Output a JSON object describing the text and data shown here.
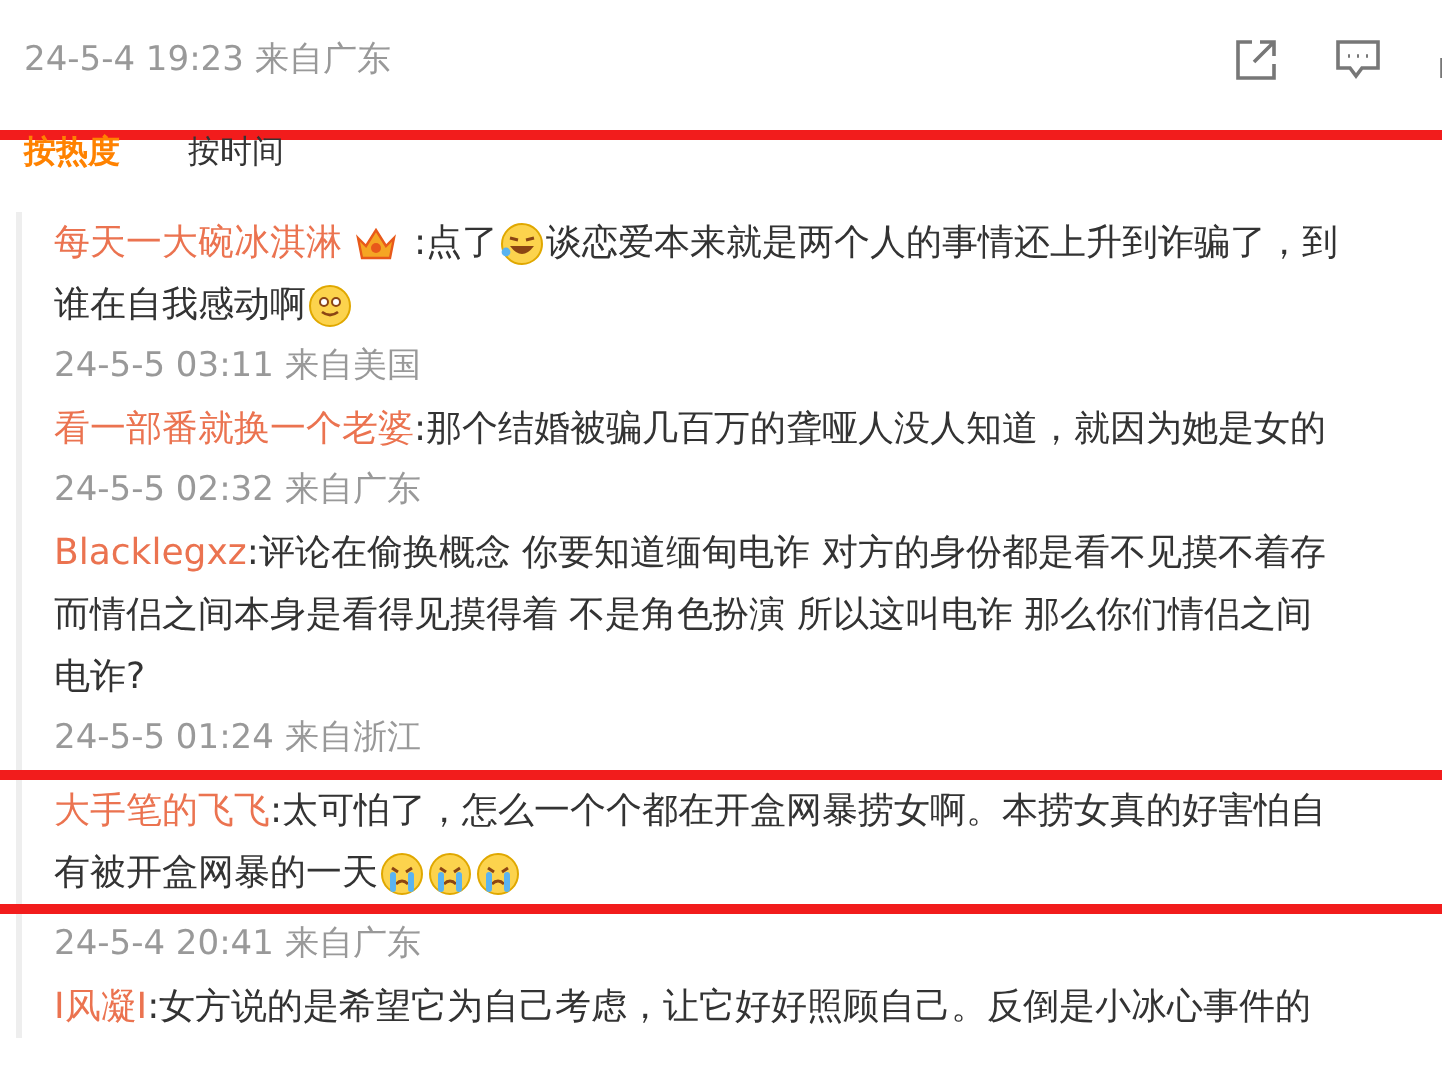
{
  "post": {
    "time": "24-5-4 19:23 来自广东"
  },
  "sort_tabs": [
    {
      "label": "按热度",
      "selected": true
    },
    {
      "label": "按时间",
      "selected": false
    }
  ],
  "comments": [
    {
      "user": "每天一大碗冰淇淋",
      "lines": [
        [
          {
            "kind": "badge"
          },
          {
            "kind": "text",
            "text": ":点了"
          },
          {
            "kind": "laugh"
          },
          {
            "kind": "text",
            "text": "谈恋爱本来就是两个人的事情还上升到诈骗了，到"
          }
        ],
        [
          {
            "kind": "text",
            "text": "谁在自我感动啊"
          },
          {
            "kind": "smile"
          }
        ]
      ],
      "time": "24-5-5 03:11 来自美国",
      "marked": false
    },
    {
      "user": "看一部番就换一个老婆",
      "lines": [
        [
          {
            "kind": "text",
            "text": ":那个结婚被骗几百万的聋哑人没人知道，就因为她是女的"
          }
        ]
      ],
      "time": "24-5-5 02:32 来自广东",
      "marked": false
    },
    {
      "user": "Blacklegxz",
      "lines": [
        [
          {
            "kind": "text",
            "text": ":评论在偷换概念 你要知道缅甸电诈 对方的身份都是看不见摸不着存"
          }
        ],
        [
          {
            "kind": "text",
            "text": "而情侣之间本身是看得见摸得着 不是角色扮演 所以这叫电诈 那么你们情侣之间"
          }
        ],
        [
          {
            "kind": "text",
            "text": "电诈?"
          }
        ]
      ],
      "time": "24-5-5 01:24 来自浙江",
      "marked": false
    },
    {
      "user": "大手笔的飞飞",
      "lines": [
        [
          {
            "kind": "text",
            "text": ":太可怕了，怎么一个个都在开盒网暴捞女啊。本捞女真的好害怕自"
          }
        ],
        [
          {
            "kind": "text",
            "text": "有被开盒网暴的一天"
          },
          {
            "kind": "cry"
          },
          {
            "kind": "cry"
          },
          {
            "kind": "cry"
          }
        ]
      ],
      "time": "24-5-4 20:41 来自广东",
      "marked": true
    },
    {
      "user": "I风凝I",
      "lines": [
        [
          {
            "kind": "text",
            "text": ":女方说的是希望它为自己考虑，让它好好照顾自己。反倒是小冰心事件的"
          }
        ]
      ],
      "marked": false
    }
  ]
}
